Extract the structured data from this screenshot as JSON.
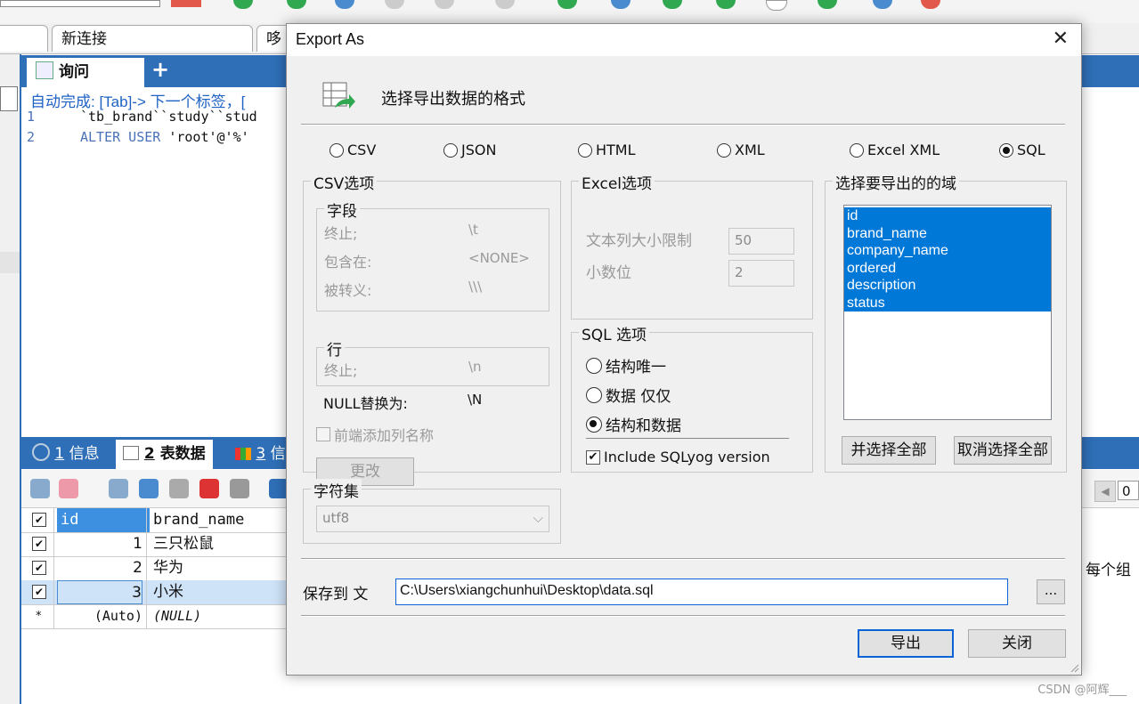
{
  "background": {
    "conn_tabs": [
      "",
      "新连接",
      "哆"
    ],
    "query_tab": "询问",
    "query_plus": "+",
    "autocomplete_hint": "自动完成: [Tab]-> 下一个标签，[",
    "editor_lines": [
      {
        "num": "1",
        "code": "`tb_brand``study``stud"
      },
      {
        "num": "2",
        "kw": "ALTER USER",
        "code": " 'root'@'%'"
      }
    ],
    "result_tabs": [
      {
        "num": "1",
        "label": "信息"
      },
      {
        "num": "2",
        "label": "表数据"
      },
      {
        "num": "3",
        "label": "信"
      }
    ],
    "grid": {
      "columns": [
        "id",
        "brand_name"
      ],
      "rows": [
        {
          "id": "1",
          "name": "三只松鼠",
          "mark": "✔"
        },
        {
          "id": "2",
          "name": "华为",
          "mark": "✔"
        },
        {
          "id": "3",
          "name": "小米",
          "mark": "✔"
        },
        {
          "id": "(Auto)",
          "name": "(NULL)",
          "mark": "*"
        }
      ]
    },
    "right_side_text": "每个组",
    "page_input": "0"
  },
  "dialog": {
    "title": "Export As",
    "close_glyph": "✕",
    "header": "选择导出数据的格式",
    "formats": [
      {
        "label": "CSV",
        "selected": false
      },
      {
        "label": "JSON",
        "selected": false
      },
      {
        "label": "HTML",
        "selected": false
      },
      {
        "label": "XML",
        "selected": false
      },
      {
        "label": "Excel XML",
        "selected": false
      },
      {
        "label": "SQL",
        "selected": true
      }
    ],
    "csv": {
      "group_label": "CSV选项",
      "field_group": "字段",
      "terminated_label": "终止;",
      "terminated_value": "\\t",
      "enclosed_label": "包含在:",
      "enclosed_value": "<NONE>",
      "escaped_label": "被转义:",
      "escaped_value": "\\\\\\",
      "line_group": "行",
      "line_terminated_label": "终止;",
      "line_terminated_value": "\\n",
      "null_label": "NULL替换为:",
      "null_value": "\\N",
      "add_header_label": "前端添加列名称",
      "change_button": "更改"
    },
    "excel": {
      "group_label": "Excel选项",
      "text_limit_label": "文本列大小限制",
      "text_limit_value": "50",
      "decimal_label": "小数位",
      "decimal_value": "2"
    },
    "sql": {
      "group_label": "SQL 选项",
      "options": [
        {
          "label": "结构唯一",
          "selected": false
        },
        {
          "label": "数据 仅仅",
          "selected": false
        },
        {
          "label": "结构和数据",
          "selected": true
        }
      ],
      "include_version_label": "Include SQLyog version",
      "include_version_checked": true
    },
    "fields": {
      "group_label": "选择要导出的的域",
      "items": [
        "id",
        "brand_name",
        "company_name",
        "ordered",
        "description",
        "status"
      ],
      "select_all": "并选择全部",
      "deselect_all": "取消选择全部"
    },
    "charset": {
      "group_label": "字符集",
      "value": "utf8"
    },
    "save_to_label": "保存到 文",
    "save_path": "C:\\Users\\xiangchunhui\\Desktop\\data.sql",
    "browse_label": "...",
    "export_button": "导出",
    "close_button": "关闭"
  },
  "watermark": "CSDN @阿辉___",
  "colors": {
    "accent_blue": "#2f6fb7",
    "selection_blue": "#0078d7"
  }
}
